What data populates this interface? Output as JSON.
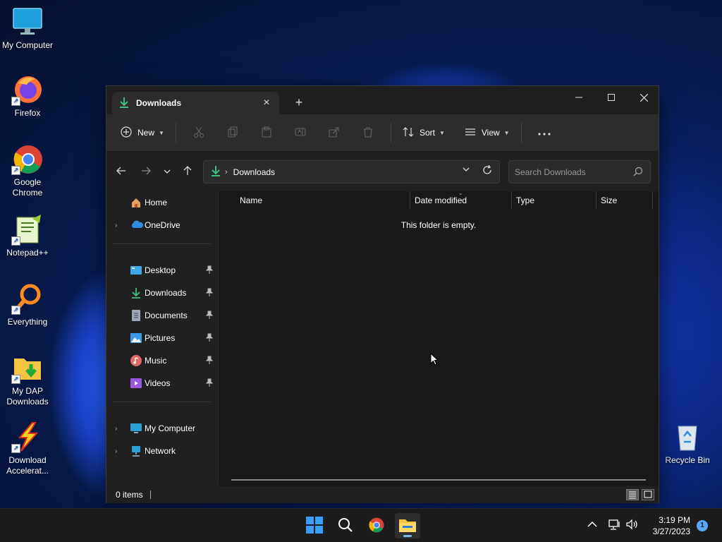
{
  "desktop": {
    "icons": [
      {
        "label": "My Computer"
      },
      {
        "label": "Firefox"
      },
      {
        "label": "Google Chrome"
      },
      {
        "label": "Notepad++"
      },
      {
        "label": "Everything"
      },
      {
        "label": "My DAP Downloads"
      },
      {
        "label": "Download Accelerat..."
      },
      {
        "label": "Recycle Bin"
      }
    ]
  },
  "window": {
    "tab_title": "Downloads",
    "toolbar": {
      "new_label": "New",
      "sort_label": "Sort",
      "view_label": "View"
    },
    "address": {
      "path": "Downloads"
    },
    "search": {
      "placeholder": "Search Downloads"
    },
    "sidebar": {
      "top": [
        {
          "label": "Home"
        },
        {
          "label": "OneDrive"
        }
      ],
      "pinned": [
        {
          "label": "Desktop"
        },
        {
          "label": "Downloads"
        },
        {
          "label": "Documents"
        },
        {
          "label": "Pictures"
        },
        {
          "label": "Music"
        },
        {
          "label": "Videos"
        }
      ],
      "bottom": [
        {
          "label": "My Computer"
        },
        {
          "label": "Network"
        }
      ]
    },
    "columns": [
      "Name",
      "Date modified",
      "Type",
      "Size"
    ],
    "empty_message": "This folder is empty.",
    "status": {
      "items": "0 items"
    }
  },
  "taskbar": {
    "time": "3:19 PM",
    "date": "3/27/2023",
    "notification_count": "1"
  },
  "colors": {
    "accent_download": "#3fbf7f",
    "window_bg": "#202020",
    "toolbar_bg": "#2c2c2c",
    "content_bg": "#191919"
  }
}
